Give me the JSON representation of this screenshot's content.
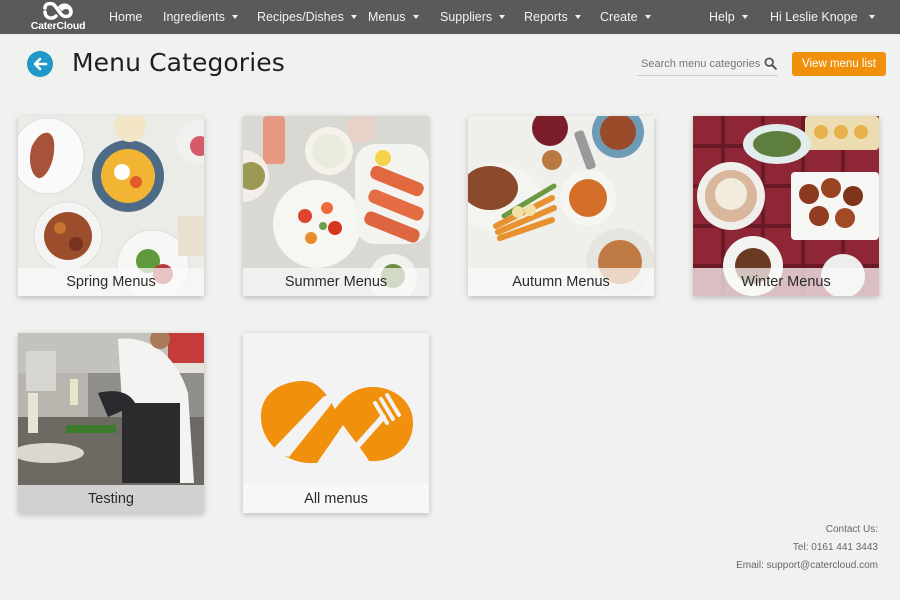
{
  "brand": {
    "name": "CaterCloud",
    "accent": "#f0900c",
    "nav_bg": "#5a5a5a"
  },
  "nav": {
    "home": "Home",
    "ingredients": "Ingredients",
    "recipes": "Recipes/Dishes",
    "menus": "Menus",
    "suppliers": "Suppliers",
    "reports": "Reports",
    "create": "Create",
    "help": "Help",
    "user": "Hi Leslie Knope"
  },
  "header": {
    "title": "Menu Categories",
    "search_placeholder": "Search menu categories",
    "view_button": "View menu list"
  },
  "categories": [
    {
      "label": "Spring Menus"
    },
    {
      "label": "Summer Menus"
    },
    {
      "label": "Autumn Menus"
    },
    {
      "label": "Winter Menus"
    },
    {
      "label": "Testing"
    },
    {
      "label": "All menus"
    }
  ],
  "footer": {
    "contact_heading": "Contact Us:",
    "tel": "Tel: 0161 441 3443",
    "email": "Email: support@catercloud.com"
  }
}
